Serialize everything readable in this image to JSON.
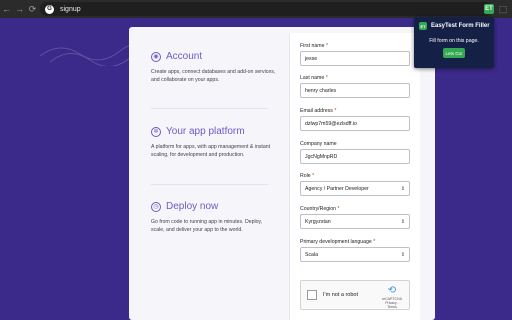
{
  "browser": {
    "url": "signup",
    "nav_back": "←",
    "nav_forward": "→",
    "nav_reload": "⟳",
    "omnibox_icon": "G",
    "extension_icon": "ET",
    "puzzle_icon": "⬚"
  },
  "features": [
    {
      "icon": "person-icon",
      "title": "Account",
      "description": "Create apps, connect databases and add-on services, and collaborate on your apps."
    },
    {
      "icon": "gear-icon",
      "title": "Your app platform",
      "description": "A platform for apps, with app management & instant scaling, for development and production."
    },
    {
      "icon": "clock-icon",
      "title": "Deploy now",
      "description": "Go from code to running app in minutes. Deploy, scale, and deliver your app to the world."
    }
  ],
  "form": {
    "first_name": {
      "label": "First name",
      "required": "*",
      "value": "jesse"
    },
    "last_name": {
      "label": "Last name",
      "required": "*",
      "value": "henry charles"
    },
    "email": {
      "label": "Email address",
      "required": "*",
      "value": "dzlwp7m59@ezlsdff.io"
    },
    "company": {
      "label": "Company name",
      "value": "JgcNgMnpRD"
    },
    "role": {
      "label": "Role",
      "required": "*",
      "value": "Agency / Partner Developer"
    },
    "country": {
      "label": "Country/Region",
      "required": "*",
      "value": "Kyrgyzstan"
    },
    "language": {
      "label": "Primary development language",
      "required": "*",
      "value": "Scala"
    }
  },
  "captcha": {
    "label": "I'm not a robot",
    "brand": "reCAPTCHA",
    "terms": "Privacy - Terms"
  },
  "popup": {
    "title": "EasyTest Form Filler",
    "message": "Fill form on this page.",
    "button": "Lets Go!",
    "logo": "ET"
  },
  "colors": {
    "background": "#3b2a8a",
    "accent": "#6f59c6",
    "popup_bg": "#152046",
    "popup_button": "#34a853"
  }
}
